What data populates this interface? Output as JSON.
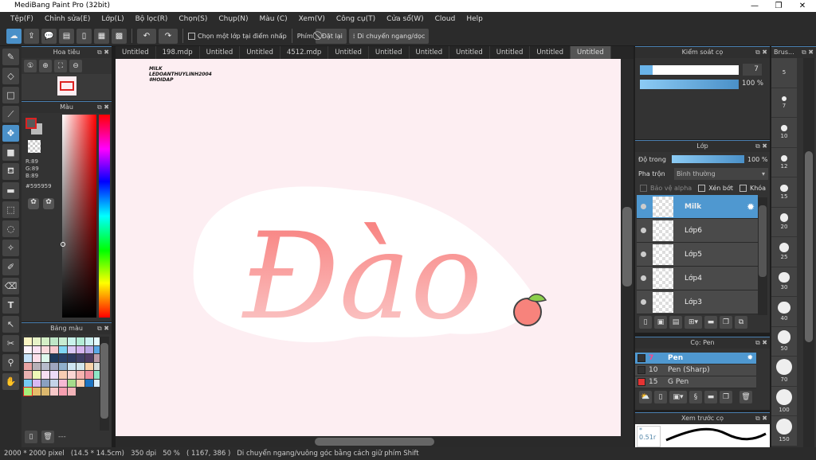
{
  "window": {
    "title": "MediBang Paint Pro (32bit)",
    "minimize": "—",
    "maximize": "❐",
    "close": "✕"
  },
  "menu": [
    "Tệp(F)",
    "Chỉnh sửa(E)",
    "Lớp(L)",
    "Bộ lọc(R)",
    "Chọn(S)",
    "Chụp(N)",
    "Màu (C)",
    "Xem(V)",
    "Công cụ(T)",
    "Cửa sổ(W)",
    "Cloud",
    "Help"
  ],
  "toolbar": {
    "select_layer_label": "Chọn một lớp tại điểm nhấp",
    "key_label": "Phím",
    "reset_label": "Đặt lại",
    "move_label": "Di chuyển ngang/dọc"
  },
  "tabs": [
    "Untitled",
    "198.mdp",
    "Untitled",
    "Untitled",
    "4512.mdp",
    "Untitled",
    "Untitled",
    "Untitled",
    "Untitled",
    "Untitled",
    "Untitled",
    "Untitled"
  ],
  "active_tab": 11,
  "navigator": {
    "title": "Hoa tiêu"
  },
  "color": {
    "title": "Màu",
    "r": "R:89",
    "g": "G:89",
    "b": "B:89",
    "hex": "#595959",
    "fg": "#595959",
    "bg": "#bbbbbb"
  },
  "palette": {
    "title": "Bảng màu",
    "footer": "---",
    "colors": [
      "#fbf5c4",
      "#e7f3c8",
      "#d4efc6",
      "#bfe6c8",
      "#c8ecd2",
      "#c9f3ec",
      "#b4ecd6",
      "#ccf1f2",
      "#e5fbff",
      "#fdf3fb",
      "#fbe3f3",
      "#fadadd",
      "#f8c9cf",
      "#7fd6f4",
      "#d9c9f5",
      "#d6b5ef",
      "#b9a8e6",
      "#5aa8e6",
      "#c6e2f8",
      "#fde0ea",
      "#ddf9ec",
      "#1f3a5c",
      "#283e66",
      "#2d3a5f",
      "#3f3f66",
      "#4d3c63",
      "#b99aa6",
      "#e8a3a3",
      "#b7b0b7",
      "#b7bccc",
      "#9fa6c0",
      "#90b0cc",
      "#cfe6f2",
      "#d3e7ec",
      "#f9d3a9",
      "#d9dfdc",
      "#eab2b2",
      "#eef9b7",
      "#f8e0f3",
      "#eddcf8",
      "#f7cdb3",
      "#fbd6d3",
      "#f6b3b0",
      "#ee8fa0",
      "#8ee6c6",
      "#76caf3",
      "#d7b8f3",
      "#8aa0c0",
      "#c3d3e8",
      "#f6b9d3",
      "#a6dc8b",
      "#fbcfb0",
      "#1d74c2",
      "#dceffc",
      "#a6ee7a",
      "#e6bc6a",
      "#dcb86e",
      "#f7c8c8",
      "#f79fb0",
      "#f2b3b8"
    ]
  },
  "canvas": {
    "watermark": [
      "MILK",
      "LEDOANTHUYLINH2004",
      "#HOIDAP"
    ],
    "artwork_text": "Đào"
  },
  "brush_control": {
    "title": "Kiểm soát cọ",
    "size": "7",
    "opacity": "100 %",
    "size_level": 0.05,
    "opacity_level": 1.0
  },
  "layers": {
    "title": "Lớp",
    "opacity_label": "Độ trong",
    "opacity_value": "100 %",
    "blend_label": "Pha trộn",
    "blend_value": "Bình thường",
    "protect_alpha": "Bảo vệ alpha",
    "clipping": "Xén bớt",
    "lock": "Khóa",
    "items": [
      {
        "name": "Milk",
        "selected": true
      },
      {
        "name": "Lớp6"
      },
      {
        "name": "Lớp5"
      },
      {
        "name": "Lớp4"
      },
      {
        "name": "Lớp3"
      }
    ]
  },
  "brushes": {
    "title": "Cọ: Pen",
    "items": [
      {
        "size": "7",
        "name": "Pen",
        "color": "#333333",
        "selected": true
      },
      {
        "size": "10",
        "name": "Pen (Sharp)",
        "color": "#333333"
      },
      {
        "size": "15",
        "name": "G Pen",
        "color": "#e53333"
      }
    ]
  },
  "brush_preview": {
    "title": "Xem trước cọ",
    "size": "0.51r"
  },
  "brush_sizes": {
    "title": "Brus...",
    "sizes": [
      "5",
      "7",
      "10",
      "12",
      "15",
      "20",
      "25",
      "30",
      "40",
      "50",
      "70",
      "100",
      "150"
    ]
  },
  "status": {
    "pixels": "2000 * 2000 pixel",
    "cm": "(14.5 * 14.5cm)",
    "dpi": "350 dpi",
    "zoom": "50 %",
    "coords": "( 1167, 386 )",
    "hint": "Di chuyển ngang/vuông góc bằng cách giữ phím Shift"
  },
  "accent": "#4f98d0"
}
